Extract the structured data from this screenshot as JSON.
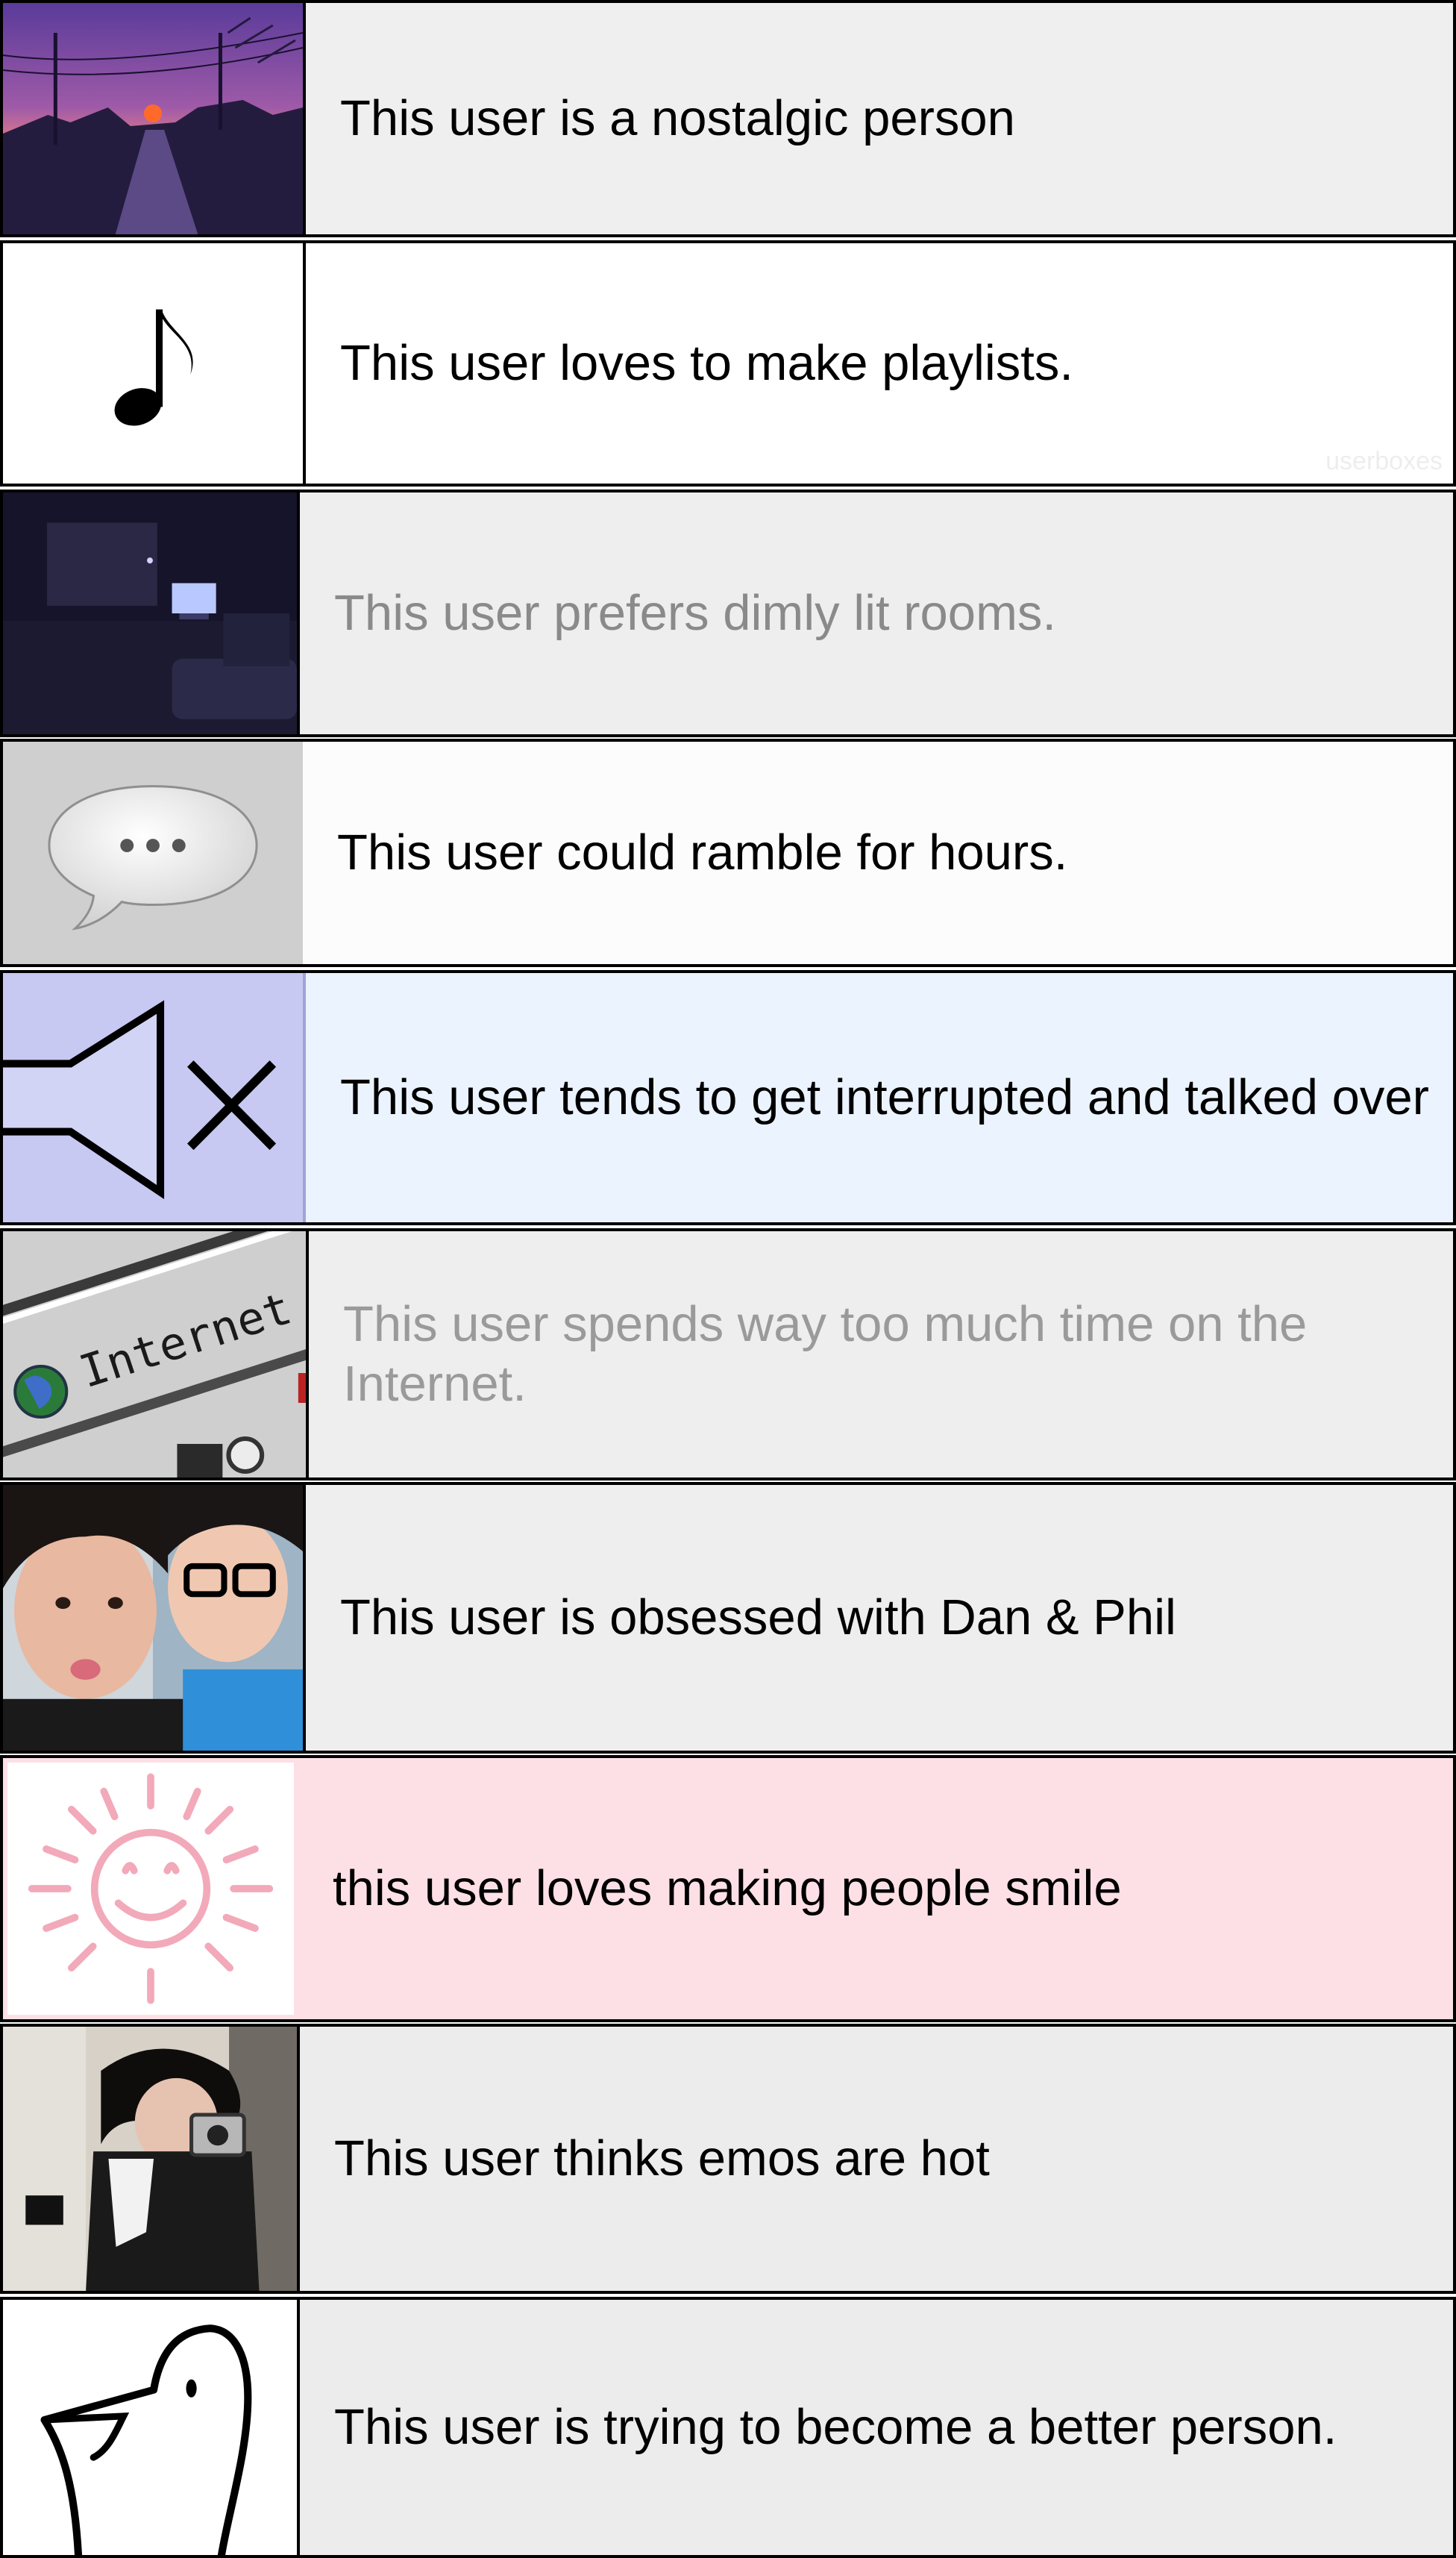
{
  "userboxes": [
    {
      "text": "This user is a nostalgic person",
      "icon": "sunset-street-photo"
    },
    {
      "text": "This user loves to make playlists.",
      "icon": "music-note-icon",
      "watermark": "userboxes"
    },
    {
      "text": "This user prefers dimly lit rooms.",
      "icon": "dim-room-photo"
    },
    {
      "text": "This user could ramble for hours.",
      "icon": "speech-bubble-icon"
    },
    {
      "text": "This user tends to get interrupted and talked over",
      "icon": "speaker-muted-icon"
    },
    {
      "text": "This user spends way too much time on the Internet.",
      "icon": "internet-icon",
      "icon_label": "Internet"
    },
    {
      "text": "This user is obsessed with Dan & Phil",
      "icon": "selfie-photo"
    },
    {
      "text": "this user loves making people smile",
      "icon": "smiling-sun-icon"
    },
    {
      "text": "This user thinks emos are hot",
      "icon": "emo-mirror-selfie-photo"
    },
    {
      "text": "This user is trying to become a better person.",
      "icon": "bird-doodle-icon"
    }
  ],
  "colors": {
    "border": "#000000",
    "nostalgic_text_bg": "#efefef",
    "playlist_bg": "#ffffff",
    "dim_text_bg": "#eeeeee",
    "dim_text": "#8a8a8a",
    "ramble_icon_bg": "#cfcfcf",
    "ramble_text_bg": "#fcfcfc",
    "interrupt_icon_bg": "#c7c9f2",
    "interrupt_text_bg": "#ebf3ff",
    "internet_text": "#9a9a9a",
    "smile_bg": "#fde0e6",
    "smile_icon": "#f2a9b9",
    "emo_text_bg": "#ececec",
    "better_text_bg": "#ececec"
  }
}
